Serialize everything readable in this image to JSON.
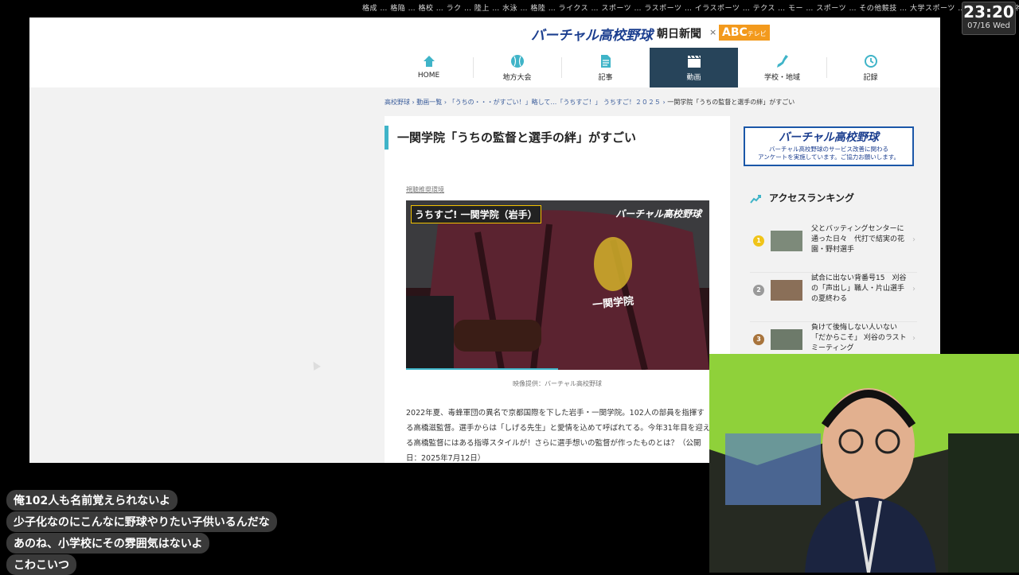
{
  "top_strip": {
    "links": "格成 … 格陥 … 格校 … ラク … 陸上 … 水泳 … 格陸 … ライクス … スポーツ … ラスポーツ … イラスポーツ … テクス … モー … スポーツ … その他競技 … 大学スポーツ … スポーツビジネス"
  },
  "clock": {
    "time": "23:20",
    "date": "07/16 Wed"
  },
  "header": {
    "logo_main": "バーチャル高校野球",
    "logo_partner": "朝日新聞",
    "logo_x": "×",
    "logo_abc": "ABC",
    "logo_abc_sub": "テレビ"
  },
  "nav": {
    "items": [
      {
        "label": "HOME",
        "icon": "home-icon"
      },
      {
        "label": "地方大会",
        "icon": "baseball-icon"
      },
      {
        "label": "記事",
        "icon": "document-icon"
      },
      {
        "label": "動画",
        "icon": "clapperboard-icon",
        "active": true
      },
      {
        "label": "学校・地域",
        "icon": "map-icon"
      },
      {
        "label": "記録",
        "icon": "clock-icon"
      }
    ]
  },
  "breadcrumb": {
    "items": [
      "高校野球",
      "動画一覧",
      "「うちの・・・がすごい！」略して…「うちすご！」 うちすご！２０２５"
    ],
    "separator": "›",
    "current": "一関学院「うちの監督と選手の絆」がすごい"
  },
  "article": {
    "title": "一関学院「うちの監督と選手の絆」がすごい",
    "nologin_link": "視聴推奨環境",
    "video": {
      "tag": "うちすご! 一関学院（岩手）",
      "overlay_logo": "バーチャル高校野球",
      "jersey_text": "一関学院",
      "progress": 0.5
    },
    "credit": "映像提供：バーチャル高校野球",
    "body": "2022年夏、毒蜂軍団の異名で京都国際を下した岩手・一関学院。102人の部員を指揮する高橋滋監督。選手からは「しげる先生」と愛情を込めて呼ばれてる。今年31年目を迎える高橋監督にはある指導スタイルが！さらに選手想いの監督が作ったものとは？（公開日：2025年7月12日）"
  },
  "sidebar": {
    "banner_title": "バーチャル高校野球",
    "banner_sub1": "バーチャル高校野球のサービス改善に関わる",
    "banner_sub2": "アンケートを実施しています。ご協力お願いします。",
    "ranking_title": "アクセスランキング",
    "ranking": [
      {
        "num": "1",
        "color": "#f0c419",
        "text": "父とバッティングセンターに通った日々　代打で結実の花園・野村選手"
      },
      {
        "num": "2",
        "color": "#9a9a9a",
        "text": "試合に出ない背番号15　刈谷の「声出し」職人・片山選手の夏終わる"
      },
      {
        "num": "3",
        "color": "#a8743c",
        "text": "負けて後悔しない人いない「だからこそ」 刈谷のラストミーティング"
      }
    ]
  },
  "chat": {
    "messages": [
      "俺102人も名前覚えられないよ",
      "少子化なのにこんなに野球やりたい子供いるんだな",
      "あのね、小学校にその雰囲気はないよ",
      "こわこいつ"
    ]
  }
}
